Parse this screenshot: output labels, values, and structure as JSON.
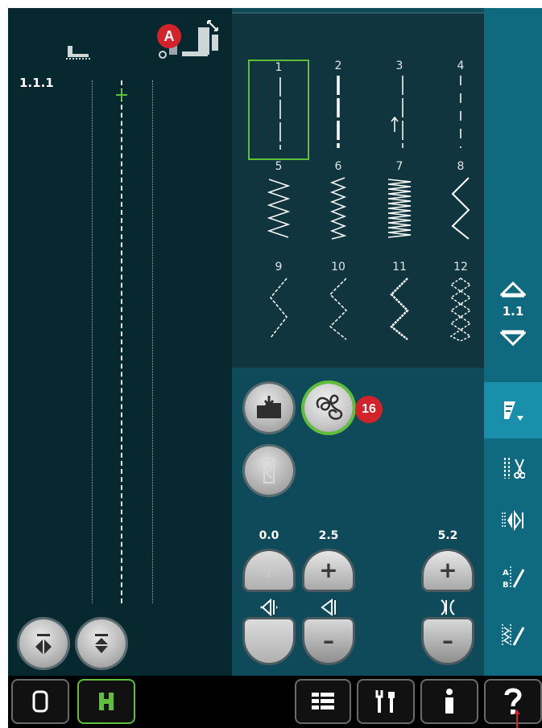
{
  "preview": {
    "stitch_id": "1.1.1"
  },
  "callouts": {
    "a": "A",
    "b": "16"
  },
  "stitches": [
    {
      "num": "1",
      "type": "straight",
      "selected": true
    },
    {
      "num": "2",
      "type": "straight-bold",
      "selected": false
    },
    {
      "num": "3",
      "type": "straight-arrow",
      "selected": false
    },
    {
      "num": "4",
      "type": "straight-dots",
      "selected": false
    },
    {
      "num": "5",
      "type": "zigzag-wide",
      "selected": false
    },
    {
      "num": "6",
      "type": "zigzag-dense",
      "selected": false
    },
    {
      "num": "7",
      "type": "satin",
      "selected": false
    },
    {
      "num": "8",
      "type": "zigzag-large",
      "selected": false
    },
    {
      "num": "9",
      "type": "three-step-zigzag",
      "selected": false
    },
    {
      "num": "10",
      "type": "three-step-zigzag-b",
      "selected": false
    },
    {
      "num": "11",
      "type": "zigzag-rugged",
      "selected": false
    },
    {
      "num": "12",
      "type": "honeycomb",
      "selected": false
    }
  ],
  "page_nav": {
    "label": "1.1"
  },
  "values": {
    "position": "0.0",
    "length": "2.5",
    "width": "5.2"
  },
  "icons": {
    "presser_foot": "presser-foot-icon",
    "sensor_foot": "sensor-foot-icon",
    "load": "load-stitch-icon",
    "free_motion": "free-motion-icon",
    "tie_off": "tie-off-icon",
    "mirror_side": "mirror-side-icon",
    "mirror_end": "mirror-end-icon"
  },
  "colors": {
    "accent_green": "#5fbe3a",
    "callout_red": "#d2232a",
    "panel_teal": "#0f6a80"
  }
}
